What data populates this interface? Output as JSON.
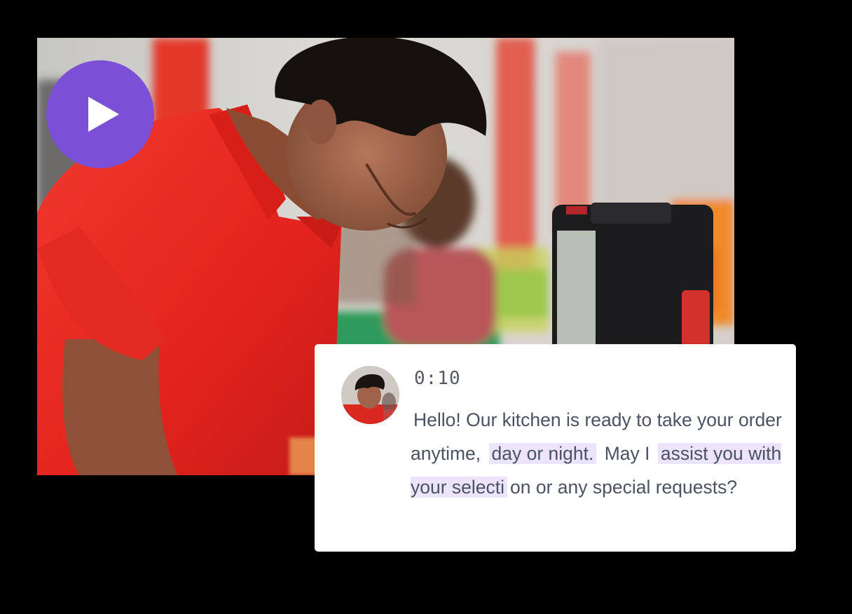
{
  "video": {
    "play_icon": "play-icon",
    "colors": {
      "play_button": "#7b4fd6",
      "shirt": "#e8231f",
      "highlight": "#ebe4fb"
    }
  },
  "transcript_card": {
    "timestamp": "0:10",
    "text_segments": [
      {
        "text": "Hello! Our kitchen is ready to take your order anytime, ",
        "highlight": false
      },
      {
        "text": "day or night.",
        "highlight": true
      },
      {
        "text": " May I ",
        "highlight": false
      },
      {
        "text": "assist you with your selecti",
        "highlight": true
      },
      {
        "text": "on or any special requests?",
        "highlight": false
      }
    ]
  }
}
